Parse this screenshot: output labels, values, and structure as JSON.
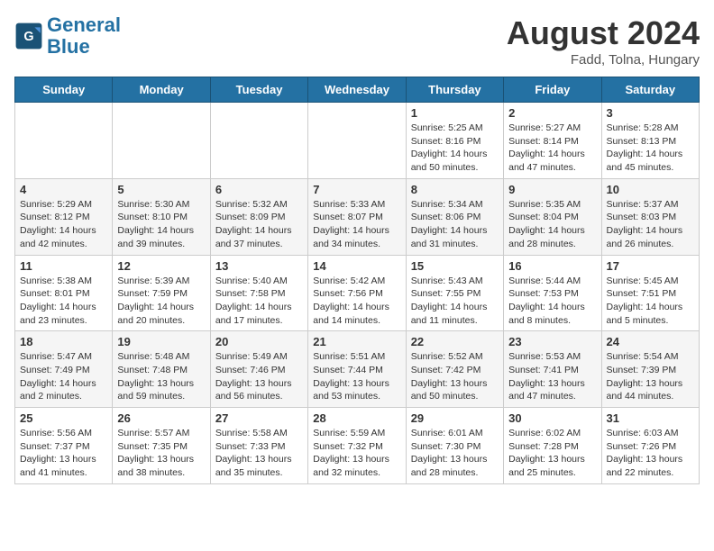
{
  "header": {
    "logo_line1": "General",
    "logo_line2": "Blue",
    "month_year": "August 2024",
    "location": "Fadd, Tolna, Hungary"
  },
  "days_of_week": [
    "Sunday",
    "Monday",
    "Tuesday",
    "Wednesday",
    "Thursday",
    "Friday",
    "Saturday"
  ],
  "weeks": [
    [
      {
        "day": "",
        "info": ""
      },
      {
        "day": "",
        "info": ""
      },
      {
        "day": "",
        "info": ""
      },
      {
        "day": "",
        "info": ""
      },
      {
        "day": "1",
        "info": "Sunrise: 5:25 AM\nSunset: 8:16 PM\nDaylight: 14 hours\nand 50 minutes."
      },
      {
        "day": "2",
        "info": "Sunrise: 5:27 AM\nSunset: 8:14 PM\nDaylight: 14 hours\nand 47 minutes."
      },
      {
        "day": "3",
        "info": "Sunrise: 5:28 AM\nSunset: 8:13 PM\nDaylight: 14 hours\nand 45 minutes."
      }
    ],
    [
      {
        "day": "4",
        "info": "Sunrise: 5:29 AM\nSunset: 8:12 PM\nDaylight: 14 hours\nand 42 minutes."
      },
      {
        "day": "5",
        "info": "Sunrise: 5:30 AM\nSunset: 8:10 PM\nDaylight: 14 hours\nand 39 minutes."
      },
      {
        "day": "6",
        "info": "Sunrise: 5:32 AM\nSunset: 8:09 PM\nDaylight: 14 hours\nand 37 minutes."
      },
      {
        "day": "7",
        "info": "Sunrise: 5:33 AM\nSunset: 8:07 PM\nDaylight: 14 hours\nand 34 minutes."
      },
      {
        "day": "8",
        "info": "Sunrise: 5:34 AM\nSunset: 8:06 PM\nDaylight: 14 hours\nand 31 minutes."
      },
      {
        "day": "9",
        "info": "Sunrise: 5:35 AM\nSunset: 8:04 PM\nDaylight: 14 hours\nand 28 minutes."
      },
      {
        "day": "10",
        "info": "Sunrise: 5:37 AM\nSunset: 8:03 PM\nDaylight: 14 hours\nand 26 minutes."
      }
    ],
    [
      {
        "day": "11",
        "info": "Sunrise: 5:38 AM\nSunset: 8:01 PM\nDaylight: 14 hours\nand 23 minutes."
      },
      {
        "day": "12",
        "info": "Sunrise: 5:39 AM\nSunset: 7:59 PM\nDaylight: 14 hours\nand 20 minutes."
      },
      {
        "day": "13",
        "info": "Sunrise: 5:40 AM\nSunset: 7:58 PM\nDaylight: 14 hours\nand 17 minutes."
      },
      {
        "day": "14",
        "info": "Sunrise: 5:42 AM\nSunset: 7:56 PM\nDaylight: 14 hours\nand 14 minutes."
      },
      {
        "day": "15",
        "info": "Sunrise: 5:43 AM\nSunset: 7:55 PM\nDaylight: 14 hours\nand 11 minutes."
      },
      {
        "day": "16",
        "info": "Sunrise: 5:44 AM\nSunset: 7:53 PM\nDaylight: 14 hours\nand 8 minutes."
      },
      {
        "day": "17",
        "info": "Sunrise: 5:45 AM\nSunset: 7:51 PM\nDaylight: 14 hours\nand 5 minutes."
      }
    ],
    [
      {
        "day": "18",
        "info": "Sunrise: 5:47 AM\nSunset: 7:49 PM\nDaylight: 14 hours\nand 2 minutes."
      },
      {
        "day": "19",
        "info": "Sunrise: 5:48 AM\nSunset: 7:48 PM\nDaylight: 13 hours\nand 59 minutes."
      },
      {
        "day": "20",
        "info": "Sunrise: 5:49 AM\nSunset: 7:46 PM\nDaylight: 13 hours\nand 56 minutes."
      },
      {
        "day": "21",
        "info": "Sunrise: 5:51 AM\nSunset: 7:44 PM\nDaylight: 13 hours\nand 53 minutes."
      },
      {
        "day": "22",
        "info": "Sunrise: 5:52 AM\nSunset: 7:42 PM\nDaylight: 13 hours\nand 50 minutes."
      },
      {
        "day": "23",
        "info": "Sunrise: 5:53 AM\nSunset: 7:41 PM\nDaylight: 13 hours\nand 47 minutes."
      },
      {
        "day": "24",
        "info": "Sunrise: 5:54 AM\nSunset: 7:39 PM\nDaylight: 13 hours\nand 44 minutes."
      }
    ],
    [
      {
        "day": "25",
        "info": "Sunrise: 5:56 AM\nSunset: 7:37 PM\nDaylight: 13 hours\nand 41 minutes."
      },
      {
        "day": "26",
        "info": "Sunrise: 5:57 AM\nSunset: 7:35 PM\nDaylight: 13 hours\nand 38 minutes."
      },
      {
        "day": "27",
        "info": "Sunrise: 5:58 AM\nSunset: 7:33 PM\nDaylight: 13 hours\nand 35 minutes."
      },
      {
        "day": "28",
        "info": "Sunrise: 5:59 AM\nSunset: 7:32 PM\nDaylight: 13 hours\nand 32 minutes."
      },
      {
        "day": "29",
        "info": "Sunrise: 6:01 AM\nSunset: 7:30 PM\nDaylight: 13 hours\nand 28 minutes."
      },
      {
        "day": "30",
        "info": "Sunrise: 6:02 AM\nSunset: 7:28 PM\nDaylight: 13 hours\nand 25 minutes."
      },
      {
        "day": "31",
        "info": "Sunrise: 6:03 AM\nSunset: 7:26 PM\nDaylight: 13 hours\nand 22 minutes."
      }
    ]
  ]
}
